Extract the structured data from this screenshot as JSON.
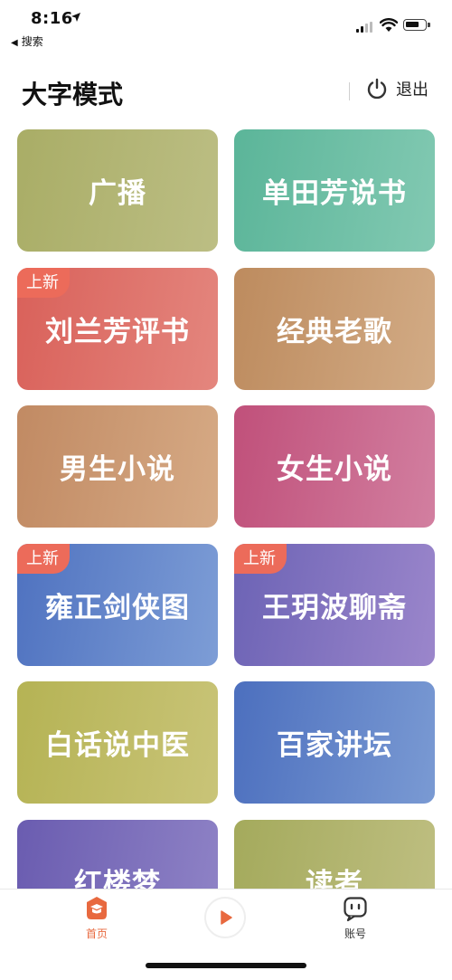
{
  "status_bar": {
    "time": "8:16",
    "back_app": "搜索"
  },
  "header": {
    "title": "大字模式",
    "exit_label": "退出"
  },
  "tiles": [
    {
      "label": "广播",
      "badge": "",
      "color_start": "#a9ad66",
      "color_end": "#bcbe84"
    },
    {
      "label": "单田芳说书",
      "badge": "",
      "color_start": "#5bb599",
      "color_end": "#82c9b2"
    },
    {
      "label": "刘兰芳评书",
      "badge": "上新",
      "color_start": "#d9615a",
      "color_end": "#e4867e"
    },
    {
      "label": "经典老歌",
      "badge": "",
      "color_start": "#bd8b5e",
      "color_end": "#d2ab85"
    },
    {
      "label": "男生小说",
      "badge": "",
      "color_start": "#c18a63",
      "color_end": "#d6aa85"
    },
    {
      "label": "女生小说",
      "badge": "",
      "color_start": "#c0507a",
      "color_end": "#d27fa0"
    },
    {
      "label": "雍正剑侠图",
      "badge": "上新",
      "color_start": "#4f72c0",
      "color_end": "#7d9dd6"
    },
    {
      "label": "王玥波聊斋",
      "badge": "上新",
      "color_start": "#6c63b5",
      "color_end": "#9b86cb"
    },
    {
      "label": "白话说中医",
      "badge": "",
      "color_start": "#b5b354",
      "color_end": "#c9c478"
    },
    {
      "label": "百家讲坛",
      "badge": "",
      "color_start": "#4c6fbe",
      "color_end": "#7a9ad3"
    },
    {
      "label": "红楼梦",
      "badge": "",
      "color_start": "#6a5cb0",
      "color_end": "#8f83c6"
    },
    {
      "label": "读者",
      "badge": "",
      "color_start": "#a4aa5c",
      "color_end": "#bfbf82"
    }
  ],
  "tabbar": {
    "home_label": "首页",
    "account_label": "账号",
    "active_color": "#e8693f",
    "inactive_color": "#333333"
  },
  "icons": {
    "exit": "power-icon",
    "home": "home-cap-icon",
    "play": "play-icon",
    "account": "chat-face-icon"
  }
}
